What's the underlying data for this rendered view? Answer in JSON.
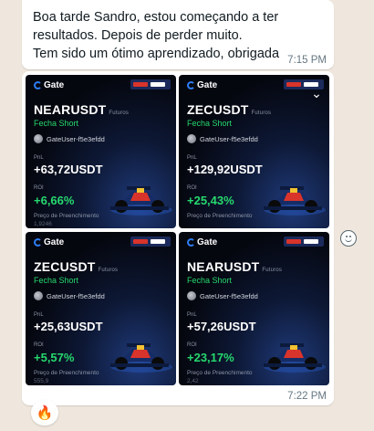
{
  "message1": {
    "lines": [
      "Boa tarde Sandro, estou começando a ter",
      "resultados. Depois de perder muito.",
      "Tem sido um ótimo aprendizado, obrigada"
    ],
    "time": "7:15 PM"
  },
  "message2": {
    "time": "7:22 PM",
    "brand": "Gate",
    "cards": [
      {
        "pair": "NEARUSDT",
        "tag": "Futuros",
        "side": "Fecha Short",
        "user": "GateUser-f5e3efdd",
        "pnl_label": "PnL",
        "pnl": "+63,72USDT",
        "roi_label": "ROI",
        "roi": "+6,66%",
        "price_label": "Preço de Preenchimento",
        "price": "1,9246"
      },
      {
        "pair": "ZECUSDT",
        "tag": "Futuros",
        "side": "Fecha Short",
        "user": "GateUser-f5e3efdd",
        "pnl_label": "PnL",
        "pnl": "+129,92USDT",
        "roi_label": "ROI",
        "roi": "+25,43%",
        "price_label": "Preço de Preenchimento",
        "price": ""
      },
      {
        "pair": "ZECUSDT",
        "tag": "Futuros",
        "side": "Fecha Short",
        "user": "GateUser-f5e3efdd",
        "pnl_label": "PnL",
        "pnl": "+25,63USDT",
        "roi_label": "ROI",
        "roi": "+5,57%",
        "price_label": "Preço de Preenchimento",
        "price": "555,9"
      },
      {
        "pair": "NEARUSDT",
        "tag": "Futuros",
        "side": "Fecha Short",
        "user": "GateUser-f5e3efdd",
        "pnl_label": "PnL",
        "pnl": "+57,26USDT",
        "roi_label": "ROI",
        "roi": "+23,17%",
        "price_label": "Preço de Preenchimento",
        "price": "2,42"
      }
    ]
  },
  "reaction": "🔥",
  "icons": {
    "chevron": "chevron-down-icon",
    "emoji": "emoji-icon",
    "car": "race-car-icon"
  },
  "colors": {
    "chat_bg": "#efe7dd",
    "bubble": "#ffffff",
    "positive": "#26d96e",
    "gate_blue": "#2d7df6"
  }
}
